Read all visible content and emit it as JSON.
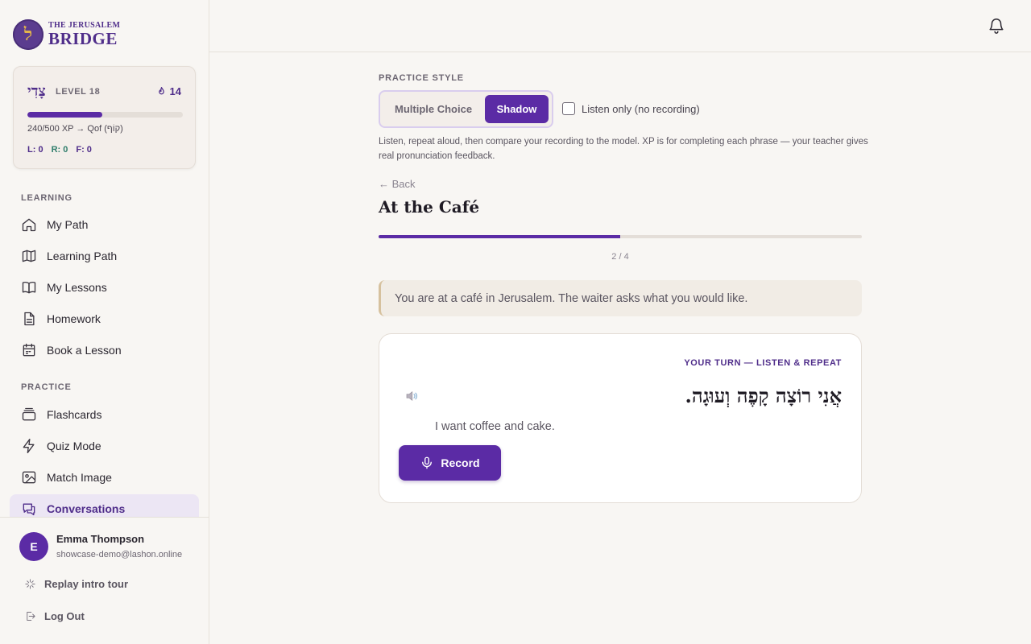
{
  "brand": {
    "small": "THE JERUSALEM",
    "big": "BRIDGE",
    "mark": "ל",
    "mark_color": "#e3b54a",
    "accent": "#5b2ba5"
  },
  "level_card": {
    "hebrew": "צָדִי",
    "level": "LEVEL 18",
    "streak": "14",
    "xp_fraction": 0.48,
    "xp_text": "240/500 XP → Qof (קוֹף)",
    "stats": {
      "l": "L: 0",
      "r": "R: 0",
      "f": "F: 0"
    }
  },
  "sidebar": {
    "learning_label": "LEARNING",
    "learning": [
      {
        "label": "My Path",
        "icon": "home-icon"
      },
      {
        "label": "Learning Path",
        "icon": "map-icon"
      },
      {
        "label": "My Lessons",
        "icon": "book-icon"
      },
      {
        "label": "Homework",
        "icon": "document-icon"
      },
      {
        "label": "Book a Lesson",
        "icon": "calendar-icon"
      }
    ],
    "practice_label": "PRACTICE",
    "practice": [
      {
        "label": "Flashcards",
        "icon": "cards-icon"
      },
      {
        "label": "Quiz Mode",
        "icon": "lightning-icon"
      },
      {
        "label": "Match Image",
        "icon": "image-icon"
      },
      {
        "label": "Conversations",
        "icon": "chat-icon",
        "active": true
      }
    ]
  },
  "user": {
    "initial": "E",
    "name": "Emma Thompson",
    "email": "showcase-demo@lashon.online",
    "replay": "Replay intro tour",
    "logout": "Log Out"
  },
  "practice": {
    "style_label": "PRACTICE STYLE",
    "option_mc": "Multiple Choice",
    "option_shadow": "Shadow",
    "selected": "Shadow",
    "listen_only": "Listen only (no recording)",
    "listen_only_checked": false,
    "description": "Listen, repeat aloud, then compare your recording to the model. XP is for completing each phrase — your teacher gives real pronunciation feedback."
  },
  "lesson": {
    "back": "← Back",
    "title": "At the Café",
    "progress_fraction": 0.5,
    "progress_text": "2 / 4",
    "scenario": "You are at a café in Jerusalem. The waiter asks what you would like."
  },
  "card": {
    "turn_label": "YOUR TURN — LISTEN & REPEAT",
    "hebrew": "אֲנִי רוֹצָה קָפֶה וְעוּגָה.",
    "translation": "I want coffee and cake.",
    "record": "Record"
  }
}
